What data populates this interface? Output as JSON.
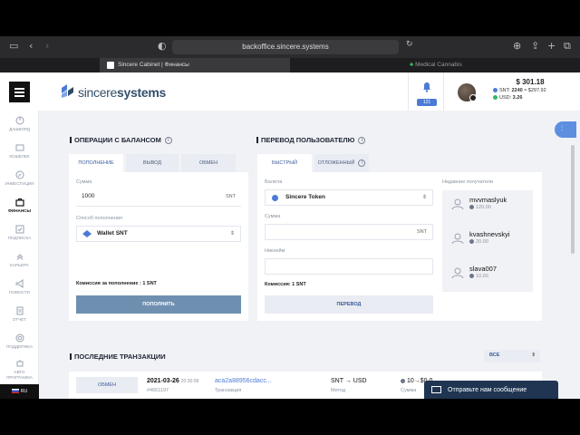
{
  "browser": {
    "url": "backoffice.sincere.systems",
    "active_tab": "Sincere Cabinet | Финансы",
    "inactive_tab": "Medical Cannabis"
  },
  "header": {
    "logo_light": "sincere",
    "logo_bold": "systems",
    "notifications_count": "121",
    "balance_total": "$ 301.18",
    "snt_label": "SNT:",
    "snt_value": "2240",
    "snt_usd": "≈ $297.92",
    "usd_label": "USD:",
    "usd_value": "3.26"
  },
  "sidebar": {
    "items": [
      {
        "label": "ДАШБОРД",
        "icon": "pie-chart-icon"
      },
      {
        "label": "КОШЕЛЕК",
        "icon": "wallet-icon"
      },
      {
        "label": "ИНВЕСТИЦИИ",
        "icon": "compass-icon"
      },
      {
        "label": "ФИНАНСЫ",
        "icon": "briefcase-icon"
      },
      {
        "label": "ПОДПИСКА",
        "icon": "checklist-icon"
      },
      {
        "label": "КАРЬЕРА",
        "icon": "chevron-stack-icon"
      },
      {
        "label": "НОВОСТИ",
        "icon": "megaphone-icon"
      },
      {
        "label": "ОТЧЕТ",
        "icon": "document-icon"
      },
      {
        "label": "ПОДДЕРЖКА",
        "icon": "lifebuoy-icon"
      },
      {
        "label": "АВТО ПРОГРАММА",
        "icon": "robot-icon"
      }
    ],
    "language": "RU"
  },
  "balance_ops": {
    "title": "ОПЕРАЦИИ С БАЛАНСОМ",
    "tabs": [
      "ПОПОЛНЕНИЕ",
      "ВЫВОД",
      "ОБМЕН"
    ],
    "amount_label": "Сумма",
    "amount_value": "1000",
    "amount_unit": "SNT",
    "method_label": "Способ пополнения",
    "method_value": "Wallet SNT",
    "fee_note": "Комиссия за пополнение : 1 SNT",
    "submit": "ПОПОЛНИТЬ"
  },
  "transfer": {
    "title": "ПЕРЕВОД ПОЛЬЗОВАТЕЛЮ",
    "tabs": [
      "БЫСТРЫЙ",
      "ОТЛОЖЕННЫЙ"
    ],
    "currency_label": "Валюта",
    "currency_value": "Sincere Token",
    "amount_label": "Сумма",
    "amount_unit": "SNT",
    "nickname_label": "Никнейм",
    "fee_note": "Комиссия: 1 SNT",
    "submit": "ПЕРЕВОД",
    "recent_title": "Недавние получатели",
    "recipients": [
      {
        "name": "mvvmaslyuk",
        "amount": "120.00"
      },
      {
        "name": "kvashnevskyi",
        "amount": "20.00"
      },
      {
        "name": "slava007",
        "amount": "10.00"
      }
    ]
  },
  "transactions": {
    "title": "ПОСЛЕДНИЕ ТРАНЗАКЦИИ",
    "filter": "ВСЕ",
    "rows": [
      {
        "type": "ОБМЕН",
        "date": "2021-03-26",
        "time": "20:30:08",
        "id": "#4651197",
        "hash": "aca2a88956cdacc...",
        "hash_label": "Транзакция",
        "pair": "SNT → USD",
        "pair_label": "Метод",
        "amount": "10→$0.0",
        "amount_label": "Сумма"
      }
    ]
  },
  "chat": {
    "label": "Отправьте нам сообщение"
  },
  "colors": {
    "accent": "#4b7bd6",
    "primary_button": "#6f8fb0",
    "dark_nav": "#1f3552"
  }
}
